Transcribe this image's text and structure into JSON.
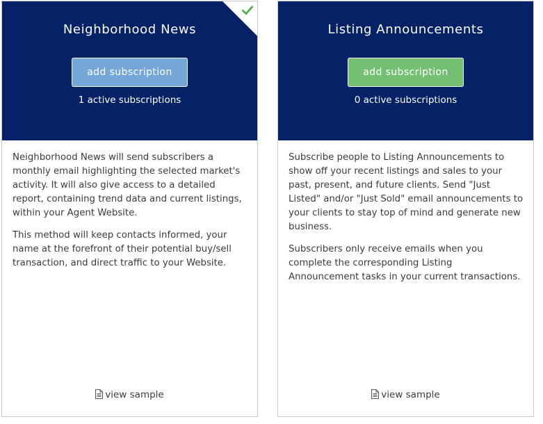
{
  "cards": [
    {
      "title": "Neighborhood News",
      "button_label": "add subscription",
      "active_count": "1 active subscriptions",
      "description": [
        "Neighborhood News will send subscribers a monthly email highlighting the selected market's activity. It will also give access to a detailed report, containing trend data and current listings, within your Agent Website.",
        "This method will keep contacts informed, your name at the forefront of their potential buy/sell transaction, and direct traffic to your Website."
      ],
      "view_sample": "view sample",
      "selected": true,
      "button_color": "#74a7d8"
    },
    {
      "title": "Listing Announcements",
      "button_label": "add subscription",
      "active_count": "0 active subscriptions",
      "description": [
        "Subscribe people to Listing Announcements to show off your recent listings and sales to your past, present, and future clients. Send \"Just Listed\" and/or \"Just Sold\" email announcements to your clients to stay top of mind and generate new business.",
        "Subscribers only receive emails when you complete the corresponding Listing Announcement tasks in your current transactions."
      ],
      "view_sample": "view sample",
      "selected": false,
      "button_color": "#74c073"
    }
  ],
  "colors": {
    "header_bg": "#052267",
    "check": "#4cae4c",
    "body_text": "#3b3b3b"
  },
  "icons": {
    "selected_marker": "check-icon",
    "sample_link": "document-icon"
  }
}
